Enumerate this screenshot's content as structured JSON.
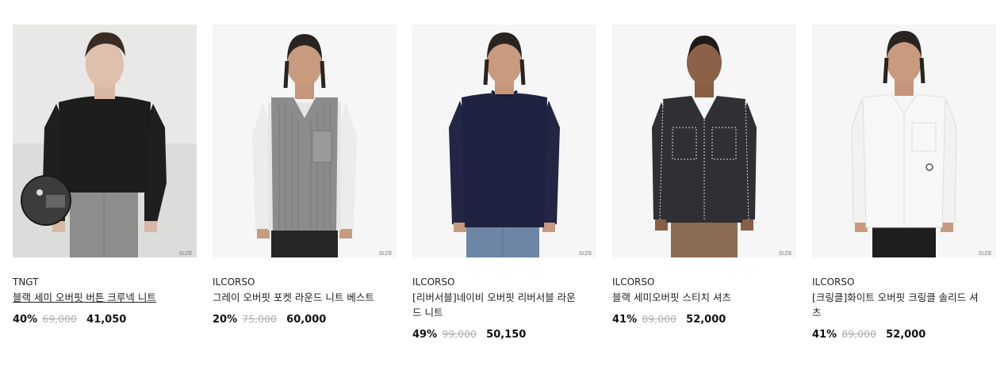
{
  "products": [
    {
      "size_label": "SIZE",
      "brand": "TNGT",
      "name": "블랙 세미 오버핏 버튼 크루넥 니트",
      "discount": "40%",
      "original_price": "69,000",
      "sale_price": "41,050",
      "garment_color": "#1d1d1d"
    },
    {
      "size_label": "SIZE",
      "brand": "ILCORSO",
      "name": "그레이 오버핏 포켓 라운드 니트 베스트",
      "discount": "20%",
      "original_price": "75,000",
      "sale_price": "60,000",
      "garment_color": "#8c8c8c"
    },
    {
      "size_label": "SIZE",
      "brand": "ILCORSO",
      "name": "[리버서블]네이비 오버핏 리버서블 라운드 니트",
      "discount": "49%",
      "original_price": "99,000",
      "sale_price": "50,150",
      "garment_color": "#1f2240"
    },
    {
      "size_label": "SIZE",
      "brand": "ILCORSO",
      "name": "블랙 세미오버핏 스티치 셔츠",
      "discount": "41%",
      "original_price": "89,000",
      "sale_price": "52,000",
      "garment_color": "#2e3033"
    },
    {
      "size_label": "SIZE",
      "brand": "ILCORSO",
      "name": "[크링클]화이트 오버핏 크링클 솔리드 셔츠",
      "discount": "41%",
      "original_price": "89,000",
      "sale_price": "52,000",
      "garment_color": "#f7f7f7"
    }
  ]
}
